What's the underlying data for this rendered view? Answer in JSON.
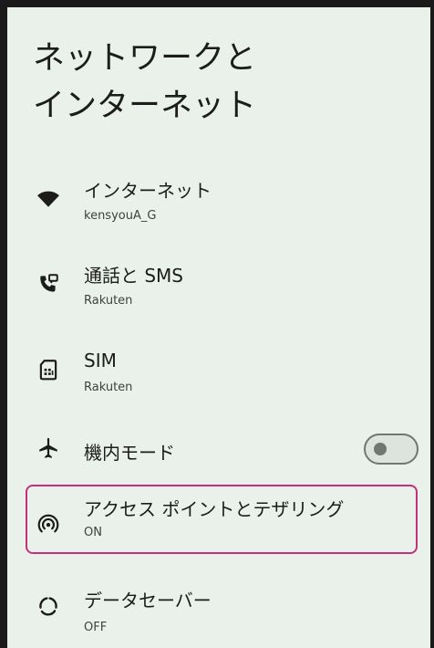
{
  "page_title": {
    "line1": "ネットワークと",
    "line2": "インターネット"
  },
  "items": [
    {
      "title": "インターネット",
      "subtitle": "kensyouA_G",
      "icon": "wifi-icon"
    },
    {
      "title": "通話と SMS",
      "subtitle": "Rakuten",
      "icon": "phone-sms-icon"
    },
    {
      "title": "SIM",
      "subtitle": "Rakuten",
      "icon": "sim-card-icon"
    },
    {
      "title": "機内モード",
      "icon": "airplane-icon",
      "toggle_on": false
    },
    {
      "title": "アクセス ポイントとテザリング",
      "subtitle": "ON",
      "icon": "hotspot-icon",
      "highlighted": true
    },
    {
      "title": "データセーバー",
      "subtitle": "OFF",
      "icon": "data-saver-icon"
    }
  ],
  "colors": {
    "background": "#eaf0ea",
    "text": "#1b1c1b",
    "highlight": "#c4307a"
  }
}
